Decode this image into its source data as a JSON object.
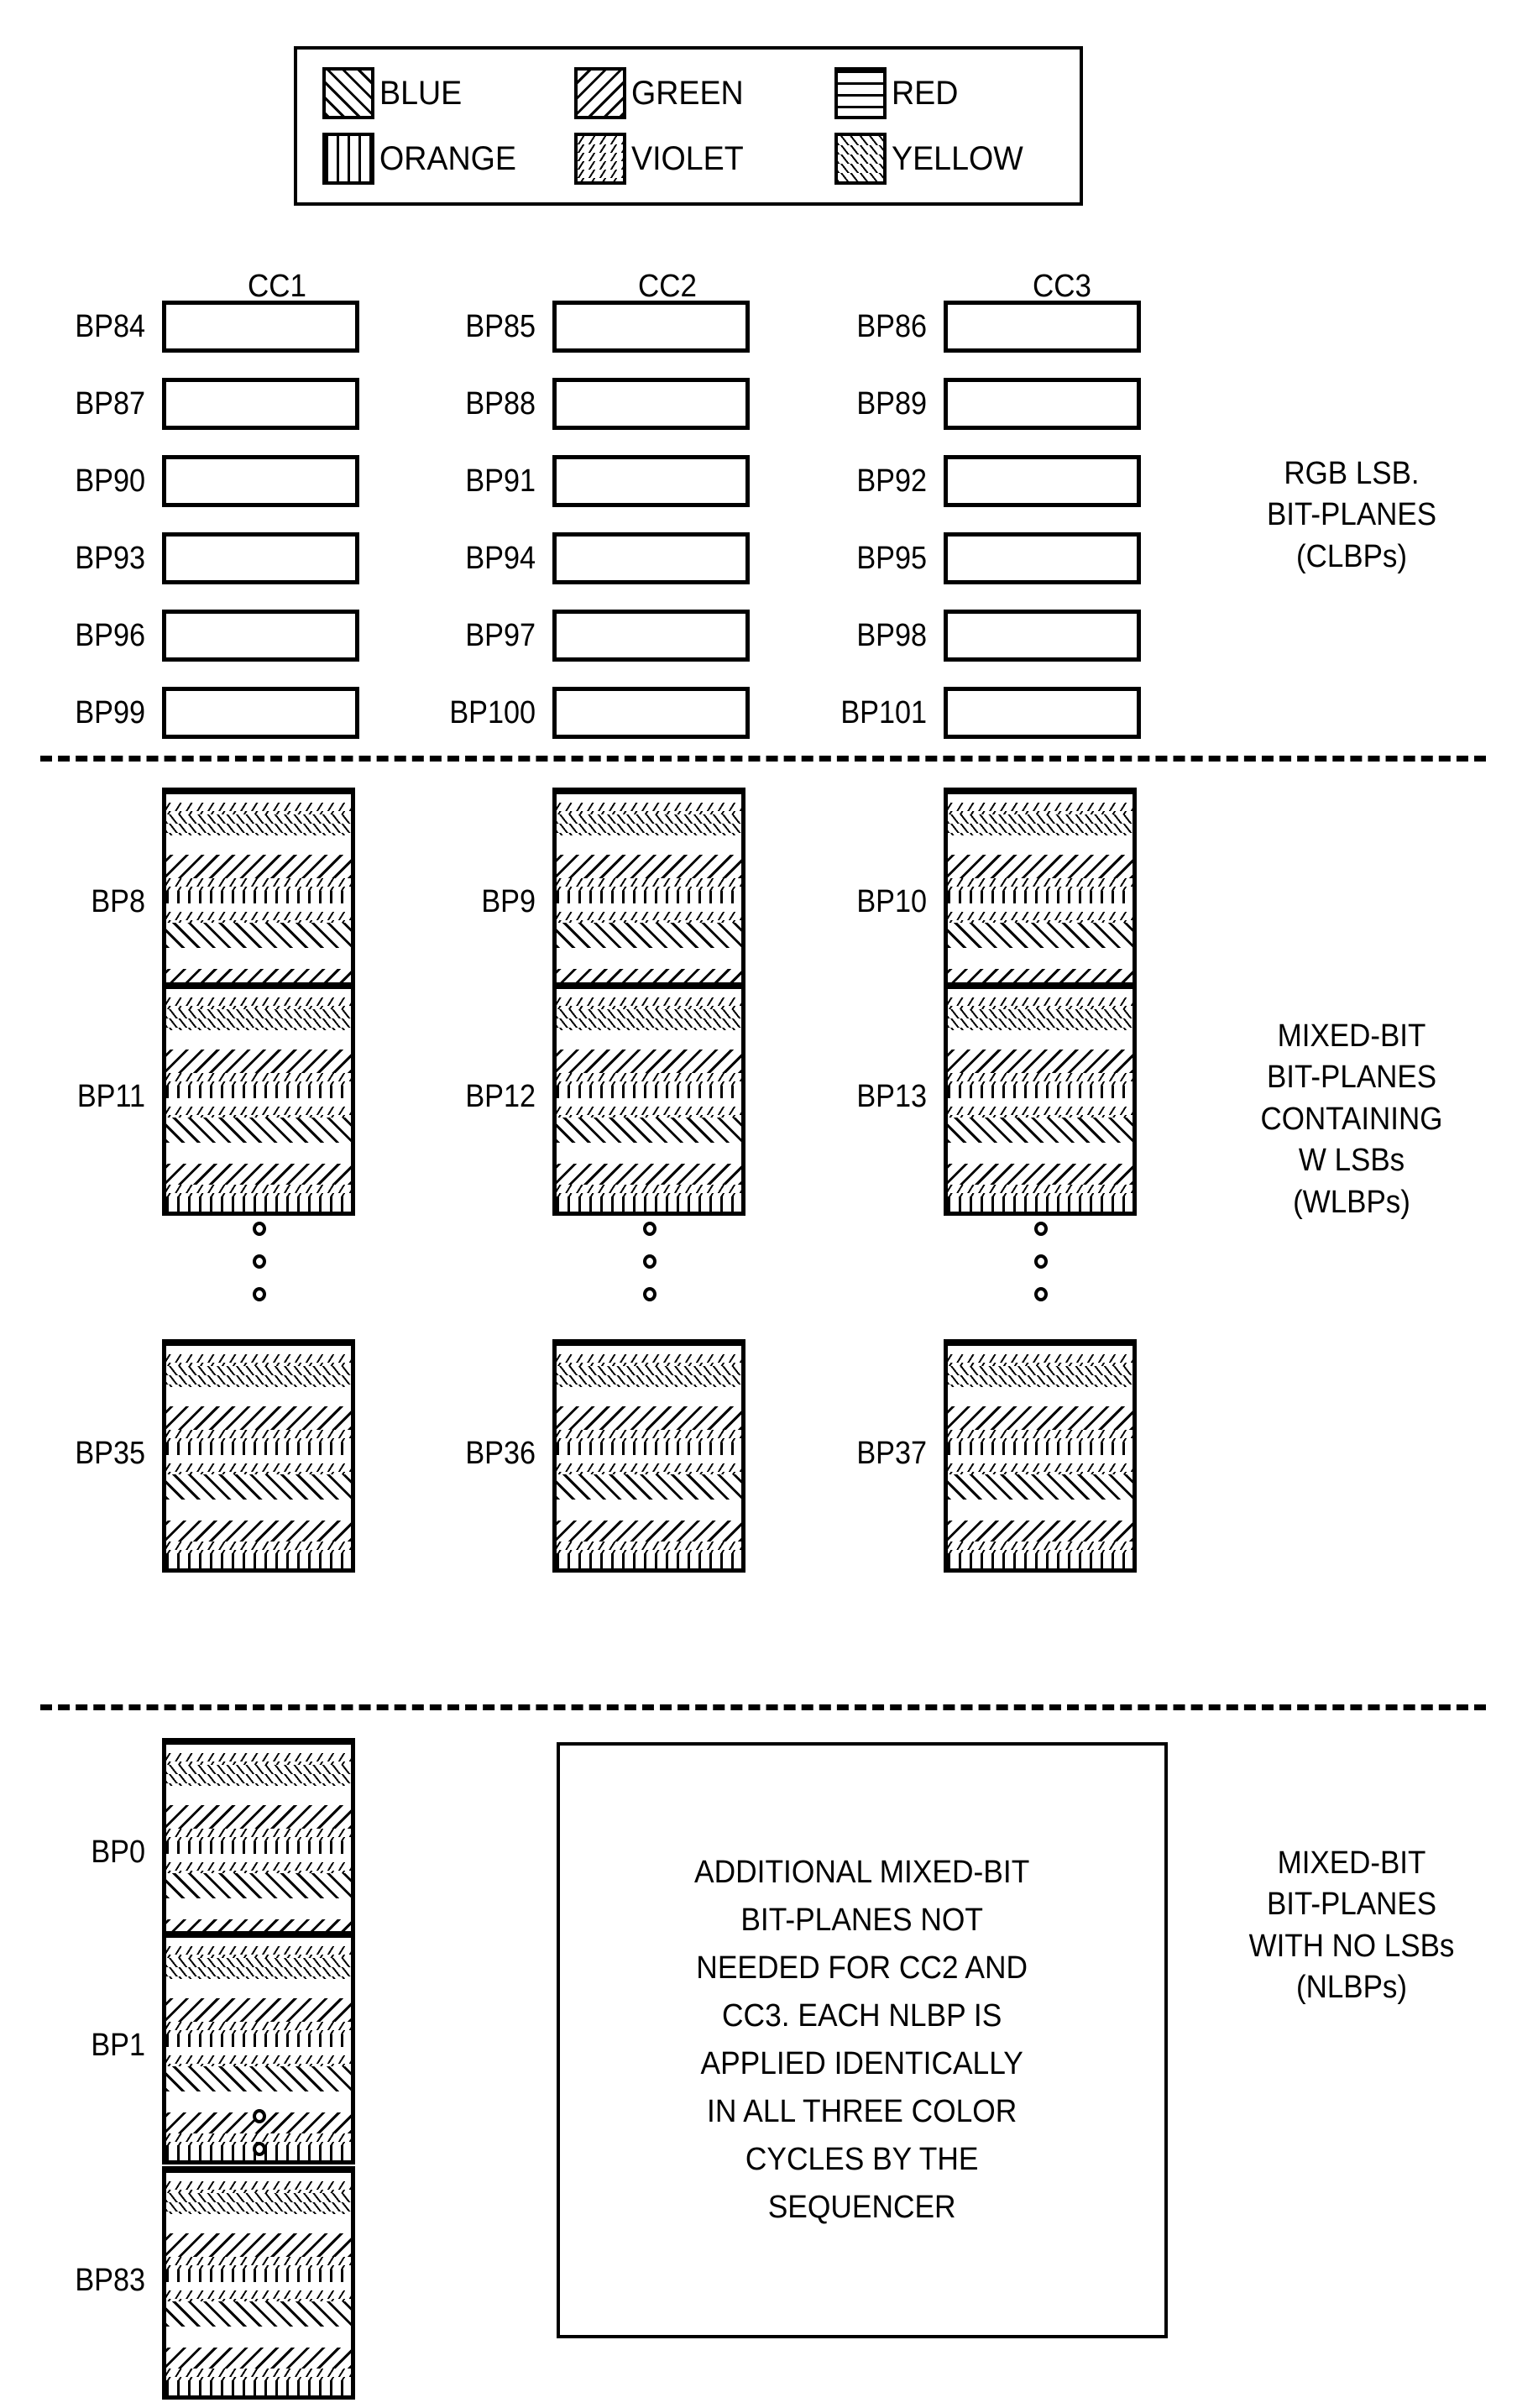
{
  "legend": {
    "rows": [
      [
        {
          "name": "BLUE",
          "pattern": "blue"
        },
        {
          "name": "GREEN",
          "pattern": "green"
        },
        {
          "name": "RED",
          "pattern": "red"
        }
      ],
      [
        {
          "name": "ORANGE",
          "pattern": "orange"
        },
        {
          "name": "VIOLET",
          "pattern": "violet"
        },
        {
          "name": "YELLOW",
          "pattern": "yellow"
        }
      ]
    ]
  },
  "columns": [
    {
      "label": "CC1"
    },
    {
      "label": "CC2"
    },
    {
      "label": "CC3"
    }
  ],
  "sections": [
    {
      "id": "clbp",
      "side_label": "RGB LSB.\nBIT-PLANES\n(CLBPs)",
      "rows": [
        {
          "cells": [
            {
              "label": "BP84",
              "pattern": "red"
            },
            {
              "label": "BP85",
              "pattern": "red"
            },
            {
              "label": "BP86",
              "pattern": "red"
            }
          ]
        },
        {
          "cells": [
            {
              "label": "BP87",
              "pattern": "red"
            },
            {
              "label": "BP88",
              "pattern": "red"
            },
            {
              "label": "BP89",
              "pattern": "red"
            }
          ]
        },
        {
          "cells": [
            {
              "label": "BP90",
              "pattern": "green"
            },
            {
              "label": "BP91",
              "pattern": "green"
            },
            {
              "label": "BP92",
              "pattern": "green"
            }
          ]
        },
        {
          "cells": [
            {
              "label": "BP93",
              "pattern": "green"
            },
            {
              "label": "BP94",
              "pattern": "green"
            },
            {
              "label": "BP95",
              "pattern": "green"
            }
          ]
        },
        {
          "cells": [
            {
              "label": "BP96",
              "pattern": "blue"
            },
            {
              "label": "BP97",
              "pattern": "blue"
            },
            {
              "label": "BP98",
              "pattern": "blue"
            }
          ]
        },
        {
          "cells": [
            {
              "label": "BP99",
              "pattern": "blue"
            },
            {
              "label": "BP100",
              "pattern": "blue"
            },
            {
              "label": "BP101",
              "pattern": "blue"
            }
          ]
        }
      ]
    },
    {
      "id": "wlbp",
      "side_label": "MIXED-BIT\nBIT-PLANES\nCONTAINING\nW LSBs\n(WLBPs)",
      "rows": [
        {
          "cells": [
            {
              "label": "BP8",
              "pattern": "mixed"
            },
            {
              "label": "BP9",
              "pattern": "mixed"
            },
            {
              "label": "BP10",
              "pattern": "mixed"
            }
          ]
        },
        {
          "cells": [
            {
              "label": "BP11",
              "pattern": "mixed"
            },
            {
              "label": "BP12",
              "pattern": "mixed"
            },
            {
              "label": "BP13",
              "pattern": "mixed"
            }
          ]
        },
        {
          "ellipsis": true
        },
        {
          "cells": [
            {
              "label": "BP35",
              "pattern": "mixed"
            },
            {
              "label": "BP36",
              "pattern": "mixed"
            },
            {
              "label": "BP37",
              "pattern": "mixed"
            }
          ]
        }
      ]
    },
    {
      "id": "nlbp",
      "side_label": "MIXED-BIT\nBIT-PLANES\nWITH NO LSBs\n(NLBPs)",
      "rows": [
        {
          "cells": [
            {
              "label": "BP0",
              "pattern": "mixed"
            }
          ]
        },
        {
          "cells": [
            {
              "label": "BP1",
              "pattern": "mixed"
            }
          ]
        },
        {
          "ellipsis": true
        },
        {
          "cells": [
            {
              "label": "BP83",
              "pattern": "mixed"
            }
          ]
        }
      ]
    }
  ],
  "note": {
    "text": "ADDITIONAL MIXED-BIT\nBIT-PLANES NOT\nNEEDED FOR CC2 AND\nCC3. EACH NLBP IS\nAPPLIED IDENTICALLY\nIN ALL THREE COLOR\nCYCLES BY THE\nSEQUENCER"
  },
  "stack_bands": [
    {
      "pattern": "red",
      "h": 10
    },
    {
      "pattern": "none",
      "h": 6
    },
    {
      "pattern": "violet",
      "h": 16
    },
    {
      "pattern": "yellow",
      "h": 30
    },
    {
      "pattern": "none",
      "h": 28
    },
    {
      "pattern": "green",
      "h": 34
    },
    {
      "pattern": "violet",
      "h": 18
    },
    {
      "pattern": "orange",
      "h": 18
    },
    {
      "pattern": "none",
      "h": 12
    },
    {
      "pattern": "violet",
      "h": 16
    },
    {
      "pattern": "blue",
      "h": 36
    },
    {
      "pattern": "none",
      "h": 30
    },
    {
      "pattern": "green",
      "h": 30
    },
    {
      "pattern": "violet",
      "h": 16
    },
    {
      "pattern": "orange",
      "h": 22
    }
  ]
}
